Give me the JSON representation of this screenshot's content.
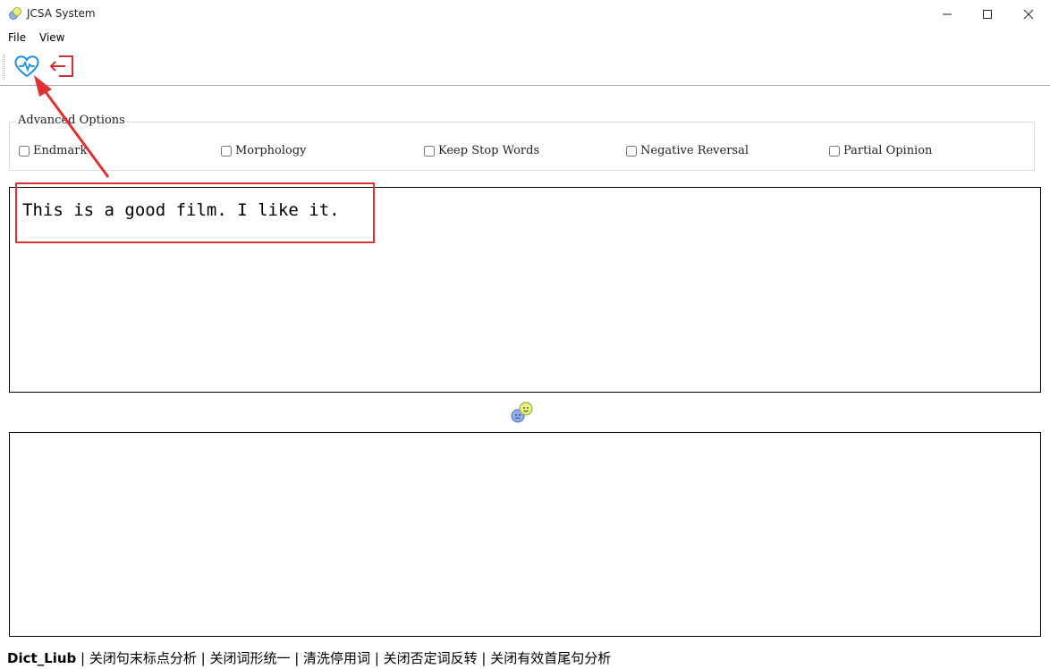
{
  "window": {
    "title": "JCSA System"
  },
  "menu": {
    "items": [
      "File",
      "View"
    ]
  },
  "toolbar": {
    "analyze_icon": "heart-pulse-icon",
    "exit_icon": "exit-icon"
  },
  "options": {
    "group_title": "Advanced Options",
    "items": [
      {
        "label": "Endmark",
        "checked": false
      },
      {
        "label": "Morphology",
        "checked": false
      },
      {
        "label": "Keep Stop Words",
        "checked": false
      },
      {
        "label": "Negative Reversal",
        "checked": false
      },
      {
        "label": "Partial Opinion",
        "checked": false
      }
    ]
  },
  "input": {
    "text": "This is a good film. I like it."
  },
  "output": {
    "text": ""
  },
  "status": {
    "dict": "Dict_Liub",
    "rest": " | 关闭句末标点分析 | 关闭词形统一 | 清洗停用词 | 关闭否定词反转 | 关闭有效首尾句分析"
  },
  "colors": {
    "accent_blue": "#1e90e0",
    "exit_red": "#d23030",
    "annotation_red": "#e03131"
  }
}
